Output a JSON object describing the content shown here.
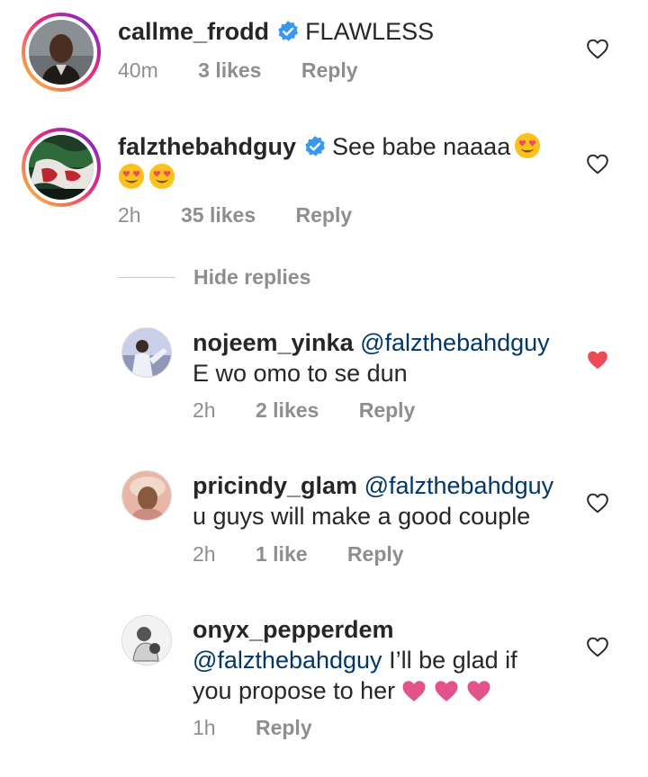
{
  "comments": [
    {
      "username": "callme_frodd",
      "text": "FLAWLESS",
      "time": "40m",
      "likes": "3 likes",
      "reply": "Reply",
      "verified": true,
      "liked": false
    },
    {
      "username": "falzthebahdguy",
      "text": "See babe naaaa",
      "time": "2h",
      "likes": "35 likes",
      "reply": "Reply",
      "verified": true,
      "liked": false
    }
  ],
  "hide_replies": "Hide replies",
  "replies": [
    {
      "username": "nojeem_yinka",
      "mention": "@falzthebahdguy",
      "text": "E wo omo to se dun",
      "time": "2h",
      "likes": "2 likes",
      "reply": "Reply",
      "liked": true
    },
    {
      "username": "pricindy_glam",
      "mention": "@falzthebahdguy",
      "text": "u guys will make a good couple",
      "time": "2h",
      "likes": "1 like",
      "reply": "Reply",
      "liked": false
    },
    {
      "username": "onyx_pepperdem",
      "mention": "@falzthebahdguy",
      "text_line1": "I’ll be glad if",
      "text_line2": "you propose to her",
      "time": "1h",
      "reply": "Reply",
      "liked": false
    }
  ],
  "colors": {
    "text": "#262626",
    "meta": "#8e8e8e",
    "mention": "#00376b",
    "verified": "#3897f0",
    "liked_heart": "#ed4956",
    "pink_heart": "#e3528a"
  },
  "icons": {
    "verified": "verified-badge-icon",
    "like": "heart-outline-icon",
    "liked": "heart-filled-icon",
    "emoji": "heart-eyes-emoji-icon",
    "pink_heart": "pink-heart-emoji-icon"
  }
}
